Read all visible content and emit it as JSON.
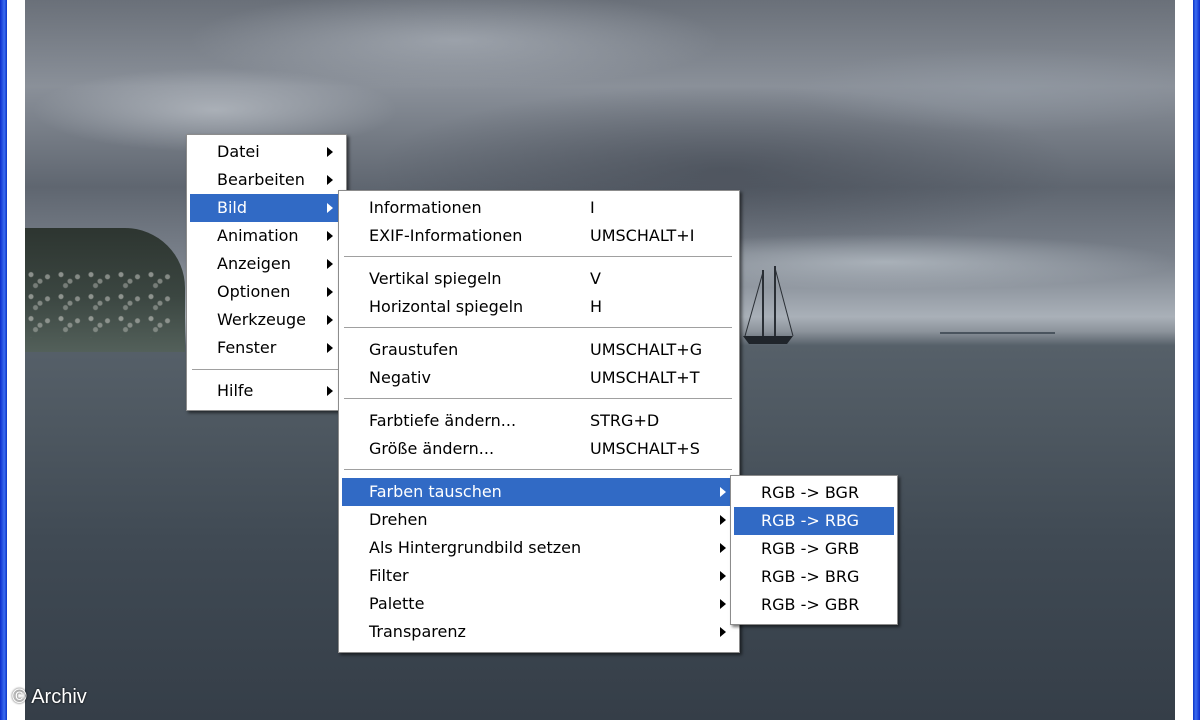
{
  "watermark": "© Archiv",
  "colors": {
    "highlight": "#316ac5",
    "menu_background": "#ffffff",
    "window_edge": "#1e46d8"
  },
  "main_menu": {
    "items": [
      {
        "label": "Datei",
        "has_submenu": true
      },
      {
        "label": "Bearbeiten",
        "has_submenu": true
      },
      {
        "label": "Bild",
        "has_submenu": true,
        "highlighted": true
      },
      {
        "label": "Animation",
        "has_submenu": true
      },
      {
        "label": "Anzeigen",
        "has_submenu": true
      },
      {
        "label": "Optionen",
        "has_submenu": true
      },
      {
        "label": "Werkzeuge",
        "has_submenu": true
      },
      {
        "label": "Fenster",
        "has_submenu": true
      },
      {
        "label": "Hilfe",
        "has_submenu": true
      }
    ]
  },
  "bild_menu": {
    "items": [
      {
        "label": "Informationen",
        "shortcut": "I"
      },
      {
        "label": "EXIF-Informationen",
        "shortcut": "UMSCHALT+I"
      },
      {
        "label": "Vertikal spiegeln",
        "shortcut": "V"
      },
      {
        "label": "Horizontal spiegeln",
        "shortcut": "H"
      },
      {
        "label": "Graustufen",
        "shortcut": "UMSCHALT+G"
      },
      {
        "label": "Negativ",
        "shortcut": "UMSCHALT+T"
      },
      {
        "label": "Farbtiefe ändern...",
        "shortcut": "STRG+D"
      },
      {
        "label": "Größe ändern...",
        "shortcut": "UMSCHALT+S"
      },
      {
        "label": "Farben tauschen",
        "has_submenu": true,
        "highlighted": true
      },
      {
        "label": "Drehen",
        "has_submenu": true
      },
      {
        "label": "Als Hintergrundbild setzen",
        "has_submenu": true
      },
      {
        "label": "Filter",
        "has_submenu": true
      },
      {
        "label": "Palette",
        "has_submenu": true
      },
      {
        "label": "Transparenz",
        "has_submenu": true
      }
    ]
  },
  "farben_menu": {
    "items": [
      {
        "label": "RGB -> BGR"
      },
      {
        "label": "RGB -> RBG",
        "highlighted": true
      },
      {
        "label": "RGB -> GRB"
      },
      {
        "label": "RGB -> BRG"
      },
      {
        "label": "RGB -> GBR"
      }
    ]
  }
}
